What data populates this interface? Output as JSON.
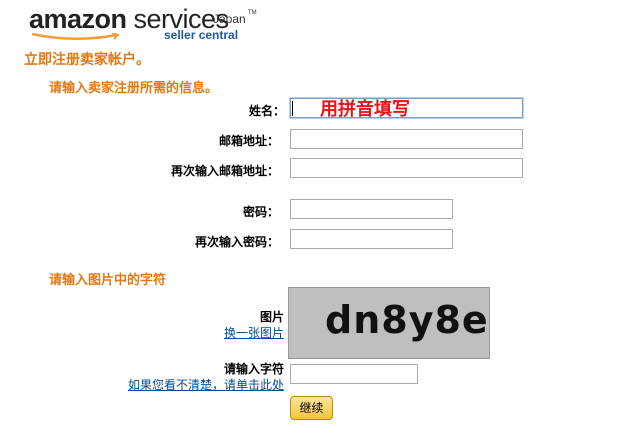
{
  "logo": {
    "brand": "amazon",
    "services": " services",
    "region": "Japan",
    "tm": "TM",
    "sub": "seller central"
  },
  "page": {
    "heading": "立即注册卖家帐户。",
    "section_info": "请输入卖家注册所需的信息。",
    "section_captcha": "请输入图片中的字符"
  },
  "form": {
    "name_label": "姓名：",
    "name_hint": "用拼音填写",
    "email_label": "邮箱地址：",
    "email_confirm_label": "再次输入邮箱地址：",
    "password_label": "密码：",
    "password_confirm_label": "再次输入密码：",
    "captcha_label": "图片",
    "captcha_change": "换一张图片",
    "captcha_text": "dn8y8e",
    "captcha_input_label": "请输入字符",
    "captcha_unclear": "如果您看不清楚，请单击此处",
    "continue_button": "继续"
  },
  "colors": {
    "accent": "#e47911",
    "hint": "#e8131b",
    "link": "#004b91",
    "logo_sub": "#1e5aa0"
  }
}
